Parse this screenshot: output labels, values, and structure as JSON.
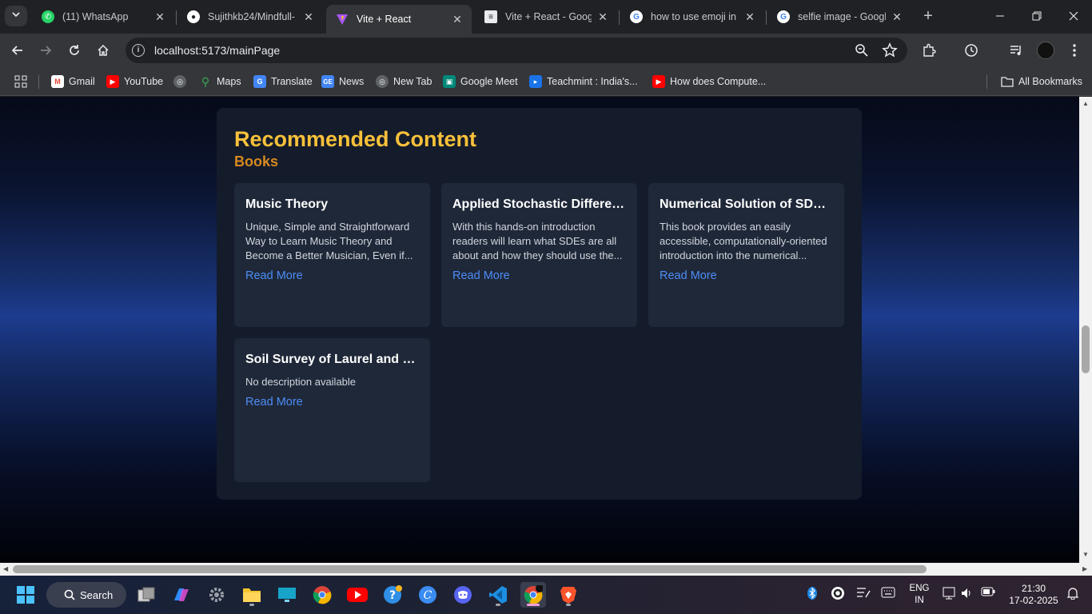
{
  "browser": {
    "tabs": [
      {
        "title": "(11) WhatsApp",
        "favicon": "whatsapp-icon",
        "active": false
      },
      {
        "title": "Sujithkb24/Mindfull-",
        "favicon": "github-icon",
        "active": false
      },
      {
        "title": "Vite + React",
        "favicon": "vite-icon",
        "active": true
      },
      {
        "title": "Vite + React - Google",
        "favicon": "docs-icon",
        "active": false
      },
      {
        "title": "how to use emoji in l",
        "favicon": "google-icon",
        "active": false
      },
      {
        "title": "selfie image - Google",
        "favicon": "google-icon",
        "active": false
      }
    ],
    "url": "localhost:5173/mainPage",
    "bookmarks": [
      {
        "label": "Gmail",
        "icon": "gmail-icon"
      },
      {
        "label": "YouTube",
        "icon": "youtube-icon"
      },
      {
        "label": "",
        "icon": "globe-icon"
      },
      {
        "label": "Maps",
        "icon": "maps-icon"
      },
      {
        "label": "Translate",
        "icon": "translate-icon"
      },
      {
        "label": "News",
        "icon": "news-icon"
      },
      {
        "label": "New Tab",
        "icon": "globe-icon"
      },
      {
        "label": "Google Meet",
        "icon": "meet-icon"
      },
      {
        "label": "Teachmint : India's...",
        "icon": "teachmint-icon"
      },
      {
        "label": "How does Compute...",
        "icon": "youtube-icon"
      }
    ],
    "all_bookmarks_label": "All Bookmarks"
  },
  "page": {
    "title": "Recommended Content",
    "subtitle": "Books",
    "read_more_label": "Read More",
    "books": [
      {
        "title": "Music Theory",
        "description": "Unique, Simple and Straightforward Way to Learn Music Theory and Become a Better Musician, Even if..."
      },
      {
        "title": "Applied Stochastic Differen...",
        "description": "With this hands-on introduction readers will learn what SDEs are all about and how they should use the..."
      },
      {
        "title": "Numerical Solution of SDE ...",
        "description": "This book provides an easily accessible, computationally-oriented introduction into the numerical..."
      },
      {
        "title": "Soil Survey of Laurel and R...",
        "description": "No description available"
      }
    ]
  },
  "taskbar": {
    "search_label": "Search",
    "language": "ENG",
    "region": "IN",
    "time": "21:30",
    "date": "17-02-2025"
  },
  "colors": {
    "title": "#f8c13a",
    "subtitle": "#d98a1f",
    "link": "#4d8df5",
    "card_bg": "#1f2839",
    "panel_bg": "#141b2b"
  }
}
